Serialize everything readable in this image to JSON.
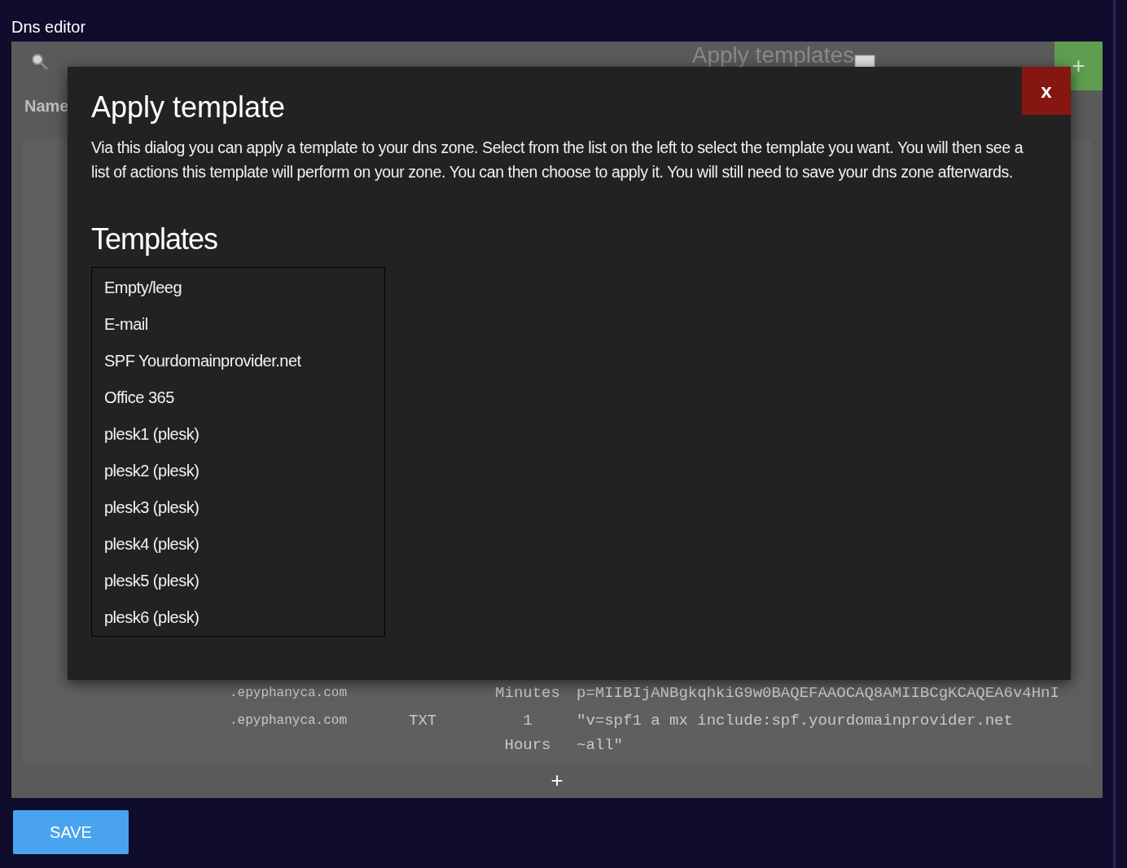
{
  "page": {
    "title": "Dns editor"
  },
  "toolbar": {
    "apply_templates": "Apply templates",
    "add_button": "+"
  },
  "table": {
    "columns": [
      "Name"
    ],
    "rows": [
      {
        "name": ".epyphanyca.com",
        "type": "",
        "ttl": "Minutes",
        "value": "p=MIIBIjANBgkqhkiG9w0BAQEFAAOCAQ8AMIIBCgKCAQEA6v4HnI"
      },
      {
        "name": ".epyphanyca.com",
        "type": "TXT",
        "ttl": "1 Hours",
        "value": "\"v=spf1 a mx include:spf.yourdomainprovider.net ~all\""
      }
    ],
    "add_row": "+"
  },
  "save_button": "SAVE",
  "dialog": {
    "title": "Apply template",
    "close": "x",
    "description": "Via this dialog you can apply a template to your dns zone. Select from the list on the left to select the template you want. You will then see a list of actions this template will perform on your zone. You can then choose to apply it. You will still need to save your dns zone afterwards.",
    "templates_heading": "Templates",
    "templates": [
      {
        "label": "Empty/leeg",
        "selected": false
      },
      {
        "label": "E-mail",
        "selected": false
      },
      {
        "label": "SPF Yourdomainprovider.net",
        "selected": false
      },
      {
        "label": "Office 365",
        "selected": false
      },
      {
        "label": "plesk1 (plesk)",
        "selected": false
      },
      {
        "label": "plesk2 (plesk)",
        "selected": false
      },
      {
        "label": "plesk3 (plesk)",
        "selected": false
      },
      {
        "label": "plesk4 (plesk)",
        "selected": false
      },
      {
        "label": "plesk5 (plesk)",
        "selected": false
      },
      {
        "label": "plesk6 (plesk)",
        "selected": false
      }
    ]
  }
}
